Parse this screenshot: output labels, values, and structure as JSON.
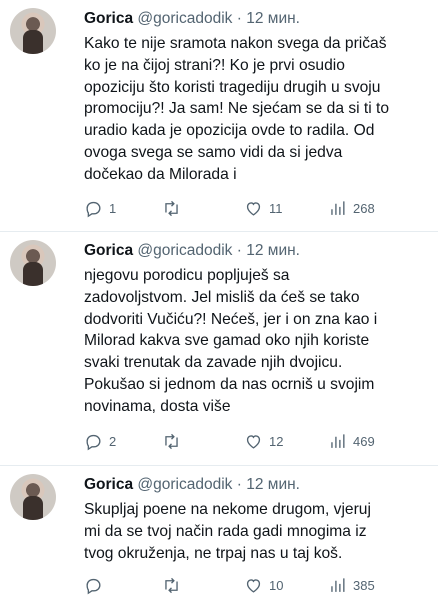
{
  "tweets": [
    {
      "name": "Gorica",
      "handle": "@goricadodik",
      "separator": "·",
      "time": "12 мин.",
      "lines": [
        "Kako te nije sramota nakon svega da pričaš",
        "ko je na čijoj strani?! Ko je prvi osudio",
        "opoziciju što koristi tragediju drugih u svoju",
        "promociju?! Ja sam! Ne sjećam se da si ti to",
        "uradio kada je opozicija ovde to radila. Od",
        "ovoga svega se samo vidi da si jedva",
        "dočekao da Milorada i"
      ],
      "replies": "1",
      "retweets": "",
      "likes": "11",
      "views": "268"
    },
    {
      "name": "Gorica",
      "handle": "@goricadodik",
      "separator": "·",
      "time": "12 мин.",
      "lines": [
        "njegovu porodicu popljuješ sa",
        "zadovoljstvom. Jel misliš da ćeš se tako",
        "dodvoriti Vučiću?! Nećeš, jer i on zna kao i",
        "Milorad kakva sve gamad oko njih koriste",
        "svaki trenutak da zavade njih dvojicu.",
        "Pokušao si jednom da nas ocrniš u svojim",
        "novinama, dosta više"
      ],
      "replies": "2",
      "retweets": "",
      "likes": "12",
      "views": "469"
    },
    {
      "name": "Gorica",
      "handle": "@goricadodik",
      "separator": "·",
      "time": "12 мин.",
      "lines": [
        "Skupljaj poene na nekome drugom, vjeruj",
        "mi da se tvoj način rada gadi mnogima iz",
        "tvog okruženja, ne trpaj nas u taj koš."
      ],
      "replies": "",
      "retweets": "",
      "likes": "10",
      "views": "385"
    }
  ],
  "icons": {
    "reply": "reply-icon",
    "retweet": "retweet-icon",
    "like": "heart-icon",
    "views": "views-icon"
  },
  "colors": {
    "text": "#0f1419",
    "secondary": "#536471",
    "divider": "#e6ecf0"
  }
}
